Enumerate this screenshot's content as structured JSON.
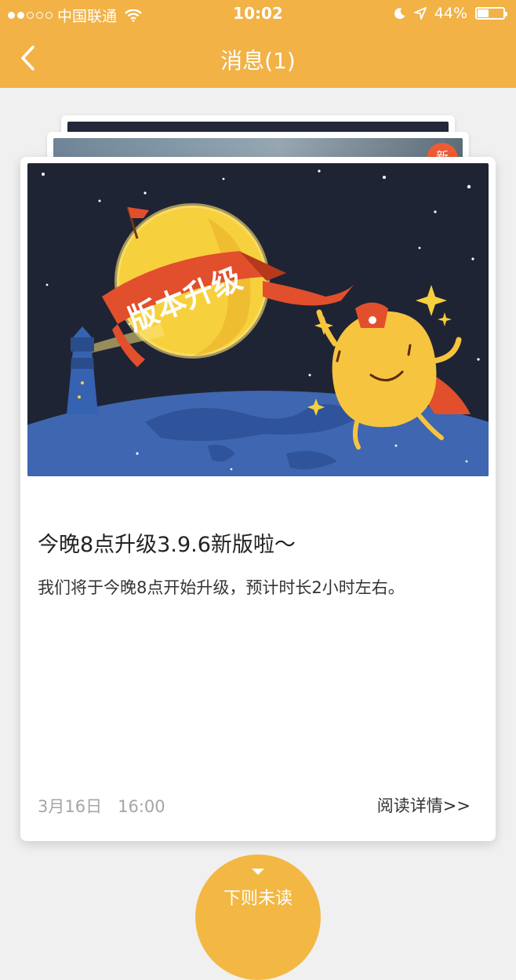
{
  "status_bar": {
    "carrier": "中国联通",
    "time": "10:02",
    "battery": "44%",
    "battery_level": 0.44
  },
  "nav": {
    "title": "消息(1)"
  },
  "stack": {
    "new_badge": "新"
  },
  "banner": {
    "ribbon_text": "版本升级"
  },
  "card": {
    "title": "今晚8点升级3.9.6新版啦～",
    "description": "我们将于今晚8点开始升级，预计时长2小时左右。",
    "date": "3月16日",
    "time": "16:00",
    "read_more": "阅读详情>>"
  },
  "next_button": {
    "label": "下则未读"
  },
  "colors": {
    "header": "#f2b246",
    "badge": "#ef5b34",
    "night_sky": "#1f2434",
    "moon": "#f7d03e",
    "ribbon": "#e24f2c",
    "earth": "#4a78c4"
  }
}
